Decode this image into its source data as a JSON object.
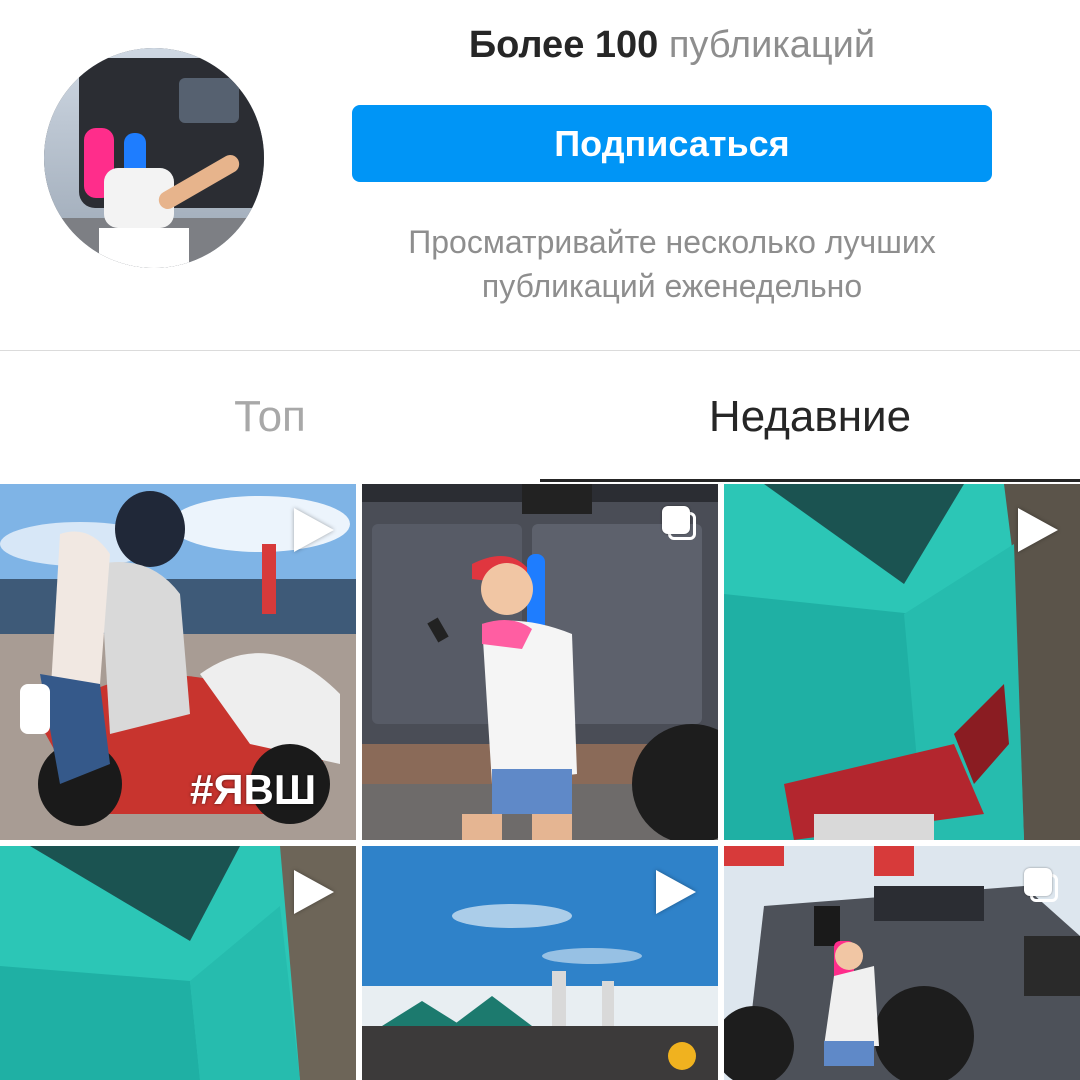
{
  "profile": {
    "pub_count_number": "Более 100",
    "pub_count_word": "публикаций",
    "subscribe_label": "Подписаться",
    "hint": "Просматривайте несколько лучших публикаций еженедельно"
  },
  "tabs": [
    {
      "label": "Топ",
      "active": false
    },
    {
      "label": "Недавние",
      "active": true
    }
  ],
  "grid": [
    {
      "type": "video",
      "overlay_text": "#ЯВШ"
    },
    {
      "type": "carousel"
    },
    {
      "type": "video"
    },
    {
      "type": "video"
    },
    {
      "type": "video"
    },
    {
      "type": "carousel"
    }
  ],
  "colors": {
    "accent": "#0095f6",
    "text_primary": "#262626",
    "text_secondary": "#8e8e8e",
    "divider": "#dbdbdb"
  }
}
